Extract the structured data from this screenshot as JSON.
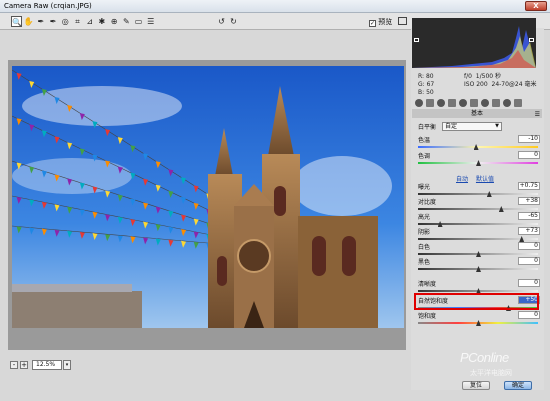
{
  "window": {
    "title": "Camera Raw (crqian.JPG)",
    "close_glyph": "X"
  },
  "toolbar": {
    "tools": [
      {
        "name": "zoom-tool-icon",
        "glyph": "🔍"
      },
      {
        "name": "hand-tool-icon",
        "glyph": "✋"
      },
      {
        "name": "white-balance-tool-icon",
        "glyph": "✒"
      },
      {
        "name": "color-sampler-tool-icon",
        "glyph": "✒"
      },
      {
        "name": "target-adjust-tool-icon",
        "glyph": "◎"
      },
      {
        "name": "crop-tool-icon",
        "glyph": "⌗"
      },
      {
        "name": "straighten-tool-icon",
        "glyph": "⊿"
      },
      {
        "name": "spot-removal-tool-icon",
        "glyph": "✱"
      },
      {
        "name": "red-eye-tool-icon",
        "glyph": "⊕"
      },
      {
        "name": "adjustment-brush-icon",
        "glyph": "✎"
      },
      {
        "name": "graduated-filter-icon",
        "glyph": "▭"
      },
      {
        "name": "preferences-icon",
        "glyph": "☰"
      },
      {
        "name": "rotate-left-icon",
        "glyph": "↺"
      },
      {
        "name": "rotate-right-icon",
        "glyph": "↻"
      }
    ],
    "preview_label": "预览",
    "preview_checked": "✓"
  },
  "status": {
    "zoom_minus": "-",
    "zoom_plus": "+",
    "zoom_value": "12.5%",
    "zoom_dropdown": "▾"
  },
  "readout": {
    "r_label": "R:",
    "r_value": "80",
    "g_label": "G:",
    "g_value": "67",
    "b_label": "B:",
    "b_value": "50",
    "aperture": "f/0",
    "shutter": "1/500 秒",
    "iso": "ISO 200",
    "lens": "24-70@24 毫米"
  },
  "panel": {
    "section_title": "基本",
    "wb_label": "白平衡",
    "wb_value": "自定",
    "auto_label": "自动",
    "default_label": "默认值",
    "sliders": [
      {
        "label": "色温",
        "value": "-10",
        "pos": 0.48,
        "track": "temp"
      },
      {
        "label": "色调",
        "value": "0",
        "pos": 0.5,
        "track": "tint"
      },
      {
        "label": "曝光",
        "value": "+0.75",
        "pos": 0.59,
        "track": "grey"
      },
      {
        "label": "对比度",
        "value": "+38",
        "pos": 0.69,
        "track": "grey"
      },
      {
        "label": "高光",
        "value": "-65",
        "pos": 0.18,
        "track": "grey"
      },
      {
        "label": "阴影",
        "value": "+73",
        "pos": 0.86,
        "track": "grey"
      },
      {
        "label": "白色",
        "value": "0",
        "pos": 0.5,
        "track": "grey"
      },
      {
        "label": "黑色",
        "value": "0",
        "pos": 0.5,
        "track": "grey"
      },
      {
        "label": "清晰度",
        "value": "0",
        "pos": 0.5,
        "track": "grey"
      },
      {
        "label": "自然饱和度",
        "value": "+50",
        "pos": 0.75,
        "track": "vib"
      },
      {
        "label": "饱和度",
        "value": "0",
        "pos": 0.5,
        "track": "sat"
      }
    ]
  },
  "buttons": {
    "reset": "复位",
    "ok": "确定"
  },
  "watermark": {
    "text": "PConline",
    "sub": "太平洋电脑网"
  }
}
